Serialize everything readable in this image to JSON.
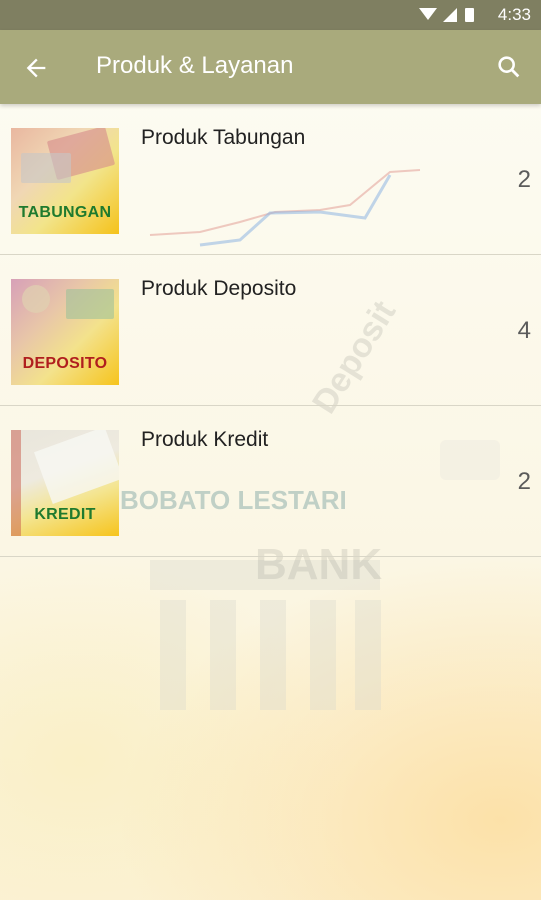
{
  "status_bar": {
    "time": "4:33"
  },
  "app_bar": {
    "title": "Produk & Layanan",
    "back_icon": "arrow-back-icon",
    "search_icon": "search-icon"
  },
  "items": [
    {
      "name": "Produk Tabungan",
      "count": "2",
      "thumb_label": "TABUNGAN",
      "label_color": "#1f7a2e"
    },
    {
      "name": "Produk Deposito",
      "count": "4",
      "thumb_label": "DEPOSITO",
      "label_color": "#b01e1e"
    },
    {
      "name": "Produk Kredit",
      "count": "2",
      "thumb_label": "KREDIT",
      "label_color": "#1f7a2e"
    }
  ],
  "background": {
    "bank_name": "BOBATO LESTARI",
    "deposit_text": "Deposit",
    "bank_text": "BANK"
  },
  "colors": {
    "app_bar": "#a9aa7c",
    "status_bar": "#7f7f61"
  }
}
